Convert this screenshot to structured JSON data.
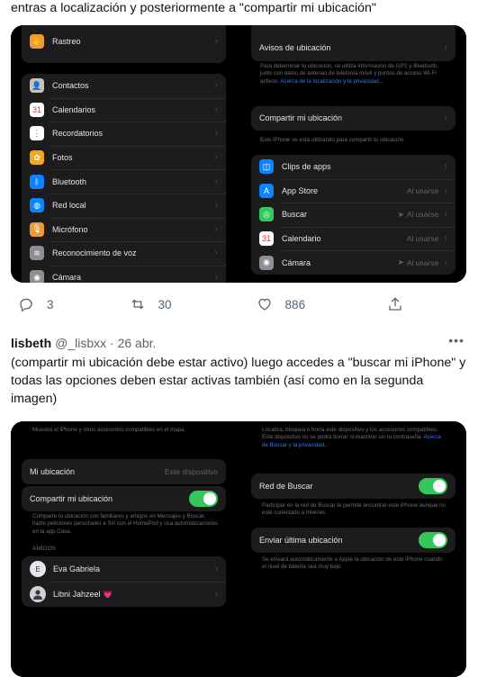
{
  "tweet1": {
    "text": "entras a localización y posteriormente a \"compartir mi ubicación\"",
    "left_rows": [
      {
        "label": "Rastreo",
        "icon": "hand-icon",
        "color": "#f09a37",
        "glyph": "✋"
      },
      {
        "label": "Contactos",
        "icon": "contacts-icon",
        "color": "#c8c3b9",
        "glyph": "👤"
      },
      {
        "label": "Calendarios",
        "icon": "calendar-icon",
        "color": "#ffffff",
        "glyph": "31"
      },
      {
        "label": "Recordatorios",
        "icon": "reminders-icon",
        "color": "#ffffff",
        "glyph": "⋮"
      },
      {
        "label": "Fotos",
        "icon": "photos-icon",
        "color": "#f5a623",
        "glyph": "✿"
      },
      {
        "label": "Bluetooth",
        "icon": "bluetooth-icon",
        "color": "#0a84ff",
        "glyph": "ᛒ"
      },
      {
        "label": "Red local",
        "icon": "globe-icon",
        "color": "#0a84ff",
        "glyph": "◍"
      },
      {
        "label": "Micrófono",
        "icon": "microphone-icon",
        "color": "#f09a37",
        "glyph": "🎙"
      },
      {
        "label": "Reconocimiento de voz",
        "icon": "voice-icon",
        "color": "#8e8e93",
        "glyph": "≋"
      },
      {
        "label": "Cámara",
        "icon": "camera-icon",
        "color": "#8e8e93",
        "glyph": "◉"
      }
    ],
    "right": {
      "avisos": "Avisos de ubicación",
      "note1": "Para determinar tu ubicación, se utiliza información de GPS y Bluetooth, junto con datos de antenas de telefonía móvil y puntos de acceso Wi-Fi activos.",
      "note1_link": "Acerca de la localización y la privacidad...",
      "compartir": "Compartir mi ubicación",
      "note2": "Este iPhone se está utilizando para compartir tu ubicación.",
      "apps": [
        {
          "label": "Clips de apps",
          "value": "",
          "arrow": false,
          "icon": "app-clips-icon",
          "color": "#0a84ff",
          "glyph": "◫"
        },
        {
          "label": "App Store",
          "value": "Al usarse",
          "arrow": false,
          "icon": "app-store-icon",
          "color": "#0a84ff",
          "glyph": "A"
        },
        {
          "label": "Buscar",
          "value": "Al usarse",
          "arrow": true,
          "icon": "find-my-icon",
          "color": "#34c759",
          "glyph": "◎"
        },
        {
          "label": "Calendario",
          "value": "Al usarse",
          "arrow": false,
          "icon": "calendar-app-icon",
          "color": "#ffffff",
          "glyph": "31"
        },
        {
          "label": "Cámara",
          "value": "Al usarse",
          "arrow": true,
          "icon": "camera-app-icon",
          "color": "#8e8e93",
          "glyph": "◉"
        }
      ]
    },
    "replies": "3",
    "retweets": "30",
    "likes": "886"
  },
  "tweet2": {
    "name": "lisbeth",
    "handle": "@_lisbxx · 26 abr.",
    "text": "(compartir mi ubicación debe estar activo) luego accedes a \"buscar mi iPhone\" y todas las opciones deben estar activas también (así como en la segunda imagen)",
    "left": {
      "top_note": "Muestra el iPhone y otros accesorios compatibles en el mapa.",
      "mi_ubicacion": "Mi ubicación",
      "mi_ubicacion_value": "Este dispositivo",
      "compartir": "Compartir mi ubicación",
      "compartir_note": "Comparte tu ubicación con familiares y amigos en Mensajes y Buscar, hazle peticiones personales a Siri con el HomePod y usa automatizaciones en la app Casa.",
      "amigos": "AMIGOS",
      "friends": [
        {
          "initial": "E",
          "name": "Eva Gabriela"
        },
        {
          "initial": "",
          "name": "Libni Jahzeel 💗"
        }
      ]
    },
    "right": {
      "top_note": "Localiza, bloquea o borra este dispositivo y los accesorios compatibles. Este dispositivo no se podrá borrar ni reactivar sin tu contraseña.",
      "top_link": "Acerca de Buscar y la privacidad...",
      "red": "Red de Buscar",
      "red_note": "Participar en la red de Buscar te permite encontrar este iPhone aunque no esté conectado a Internet.",
      "enviar": "Enviar última ubicación",
      "enviar_note": "Se enviará automáticamente a Apple la ubicación de este iPhone cuando el nivel de batería sea muy bajo."
    }
  }
}
